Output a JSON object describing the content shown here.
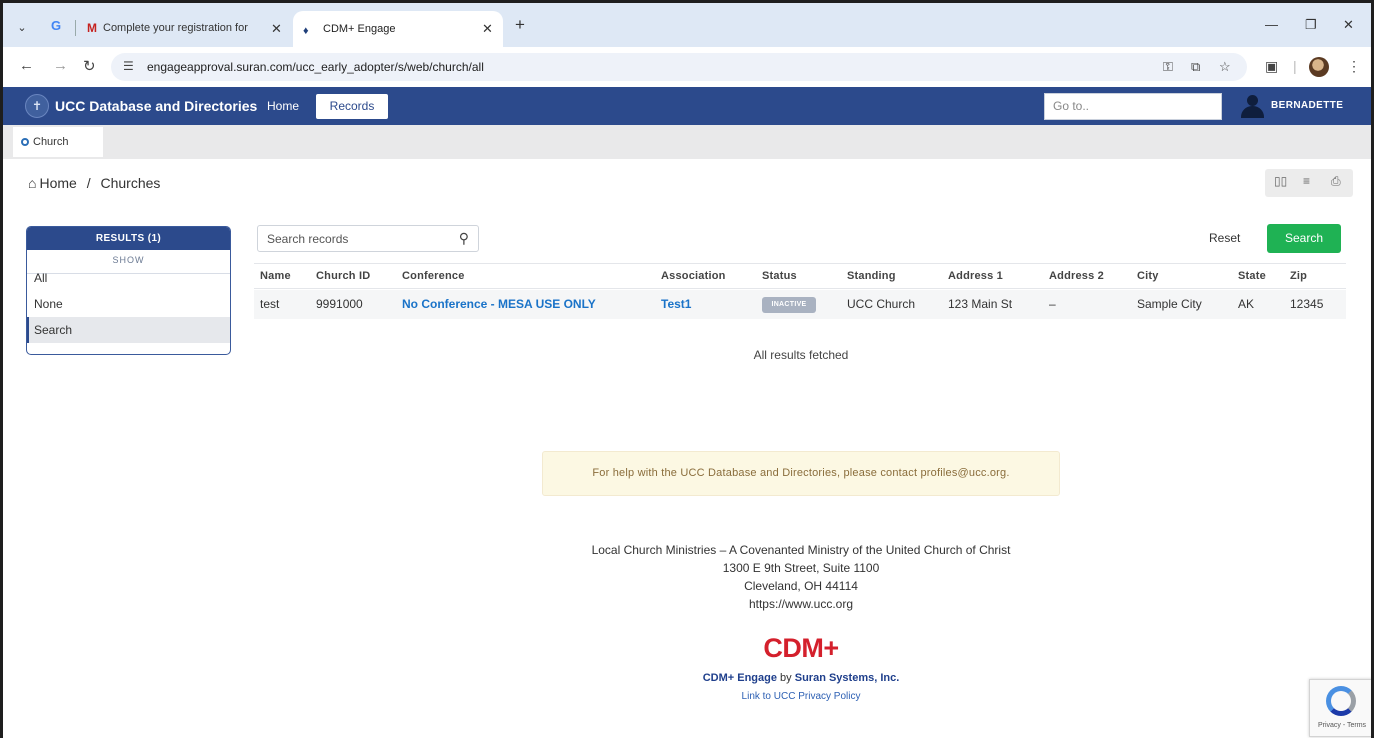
{
  "browser": {
    "tabs": [
      {
        "label": "Complete your registration for ",
        "icon": "gmail-icon"
      },
      {
        "label": "CDM+ Engage",
        "icon": "cdm-favicon"
      }
    ],
    "url": "engageapproval.suran.com/ucc_early_adopter/s/web/church/all"
  },
  "header": {
    "title": "UCC Database and Directories",
    "nav": {
      "home": "Home",
      "records": "Records"
    },
    "goto_placeholder": "Go to..",
    "user": "BERNADETTE"
  },
  "record_tab": "Church",
  "breadcrumb": {
    "home": "Home",
    "sep": "/",
    "current": "Churches"
  },
  "sidebar": {
    "results_label": "RESULTS (1)",
    "show_label": "SHOW",
    "items": [
      "All",
      "None",
      "Search"
    ],
    "active": "Search"
  },
  "search": {
    "placeholder": "Search records",
    "reset": "Reset",
    "submit": "Search"
  },
  "table": {
    "headers": [
      "Name",
      "Church ID",
      "Conference",
      "Association",
      "Status",
      "Standing",
      "Address 1",
      "Address 2",
      "City",
      "State",
      "Zip"
    ],
    "rows": [
      {
        "name": "test",
        "church_id": "9991000",
        "conference": "No Conference - MESA USE ONLY",
        "association": "Test1",
        "status": "INACTIVE",
        "standing": "UCC Church",
        "address1": "123 Main St",
        "address2": "–",
        "city": "Sample City",
        "state": "AK",
        "zip": "12345"
      }
    ]
  },
  "fetched_text": "All results fetched",
  "help_text": "For help with the UCC Database and Directories, please contact profiles@ucc.org.",
  "footer": {
    "org": "Local Church Ministries – A Covenanted Ministry of the United Church of Christ",
    "street": "1300 E 9th Street, Suite 1100",
    "city": "Cleveland, OH 44114",
    "web": "https://www.ucc.org",
    "logo": "CDM+",
    "credit_product": "CDM+ Engage",
    "credit_by": "by",
    "credit_company": "Suran Systems, Inc.",
    "privacy": "Link to UCC Privacy Policy"
  },
  "recaptcha": "Privacy - Terms",
  "colors": {
    "header_bg": "#2c4a8c",
    "search_button": "#1fb254",
    "link": "#1a73c8",
    "logo_red": "#d4202c",
    "help_bg": "#fcf8e3"
  }
}
